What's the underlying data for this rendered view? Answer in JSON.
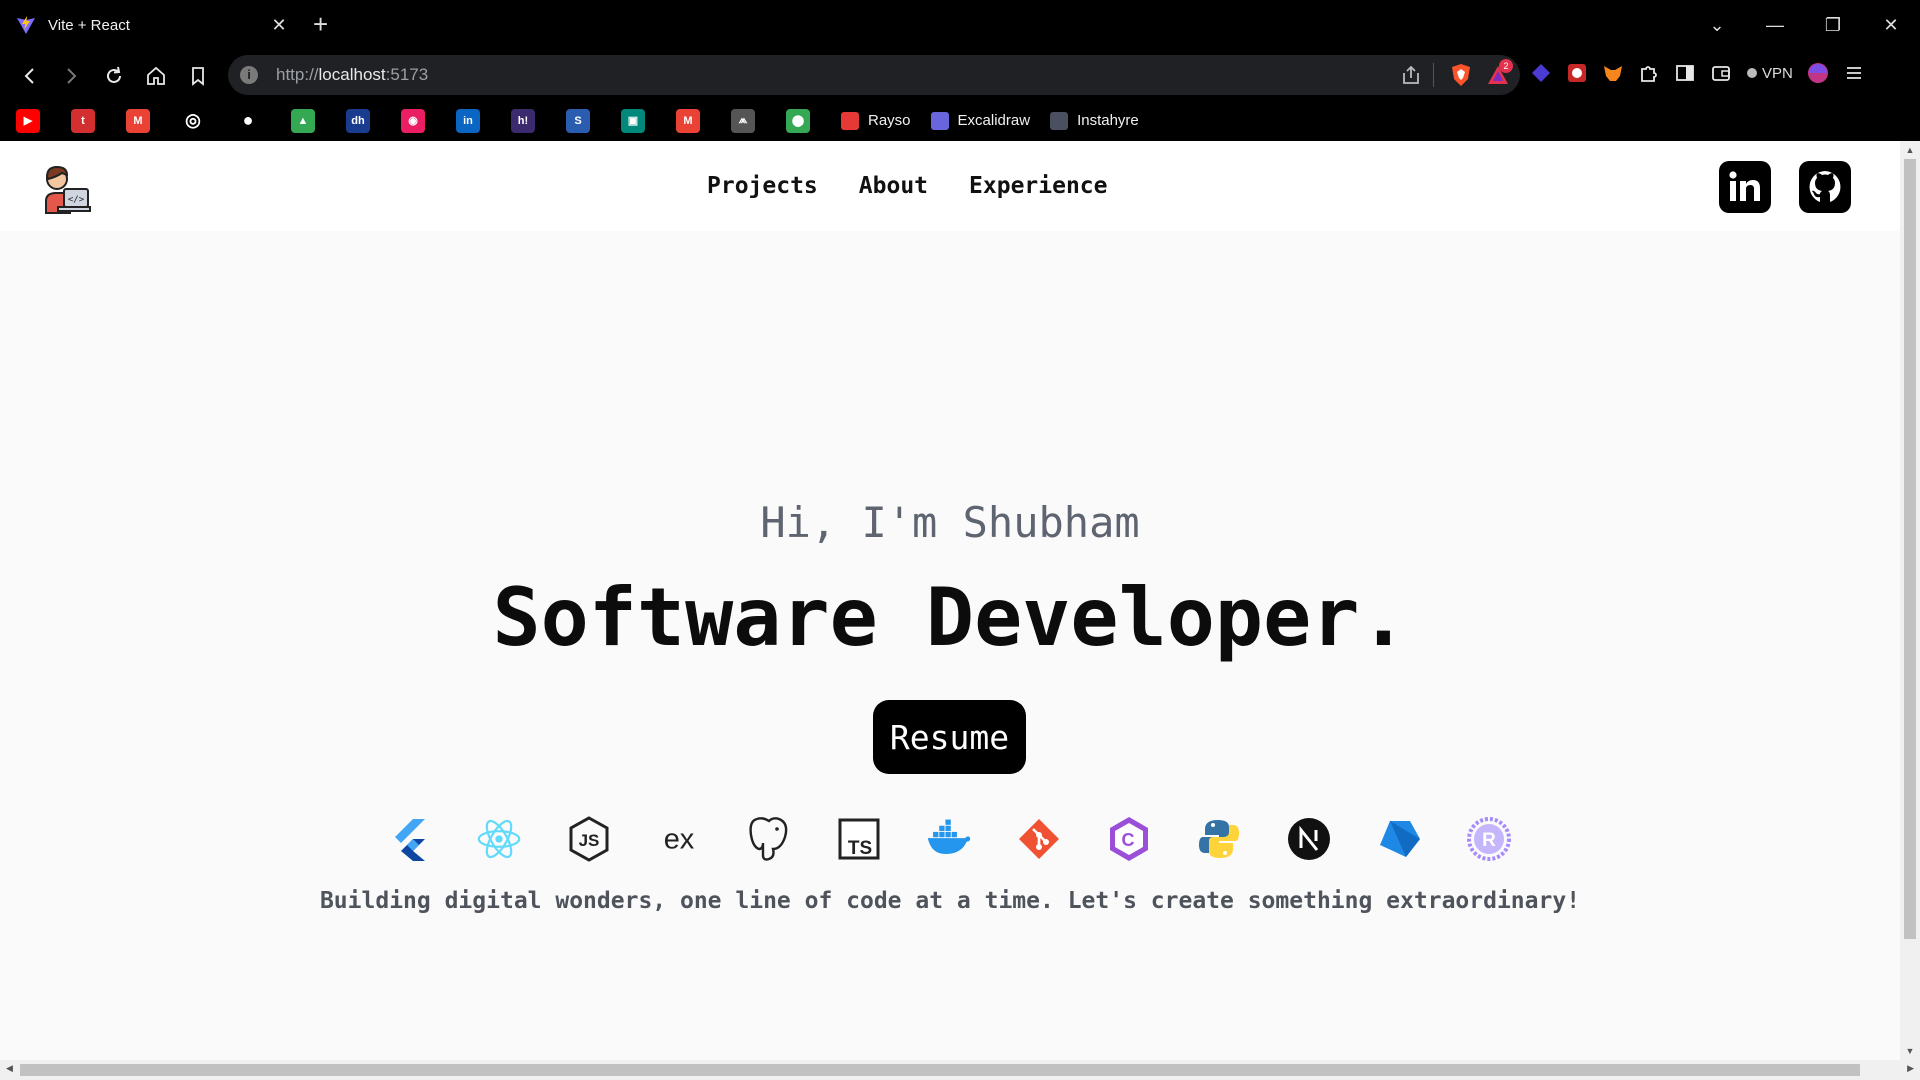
{
  "browser": {
    "tab_title": "Vite + React",
    "tab_close": "✕",
    "new_tab": "+",
    "window_controls": [
      "⌄",
      "—",
      "❐",
      "✕"
    ],
    "url_scheme": "http://",
    "url_host": "localhost",
    "url_port": ":5173",
    "vpn_label": "VPN",
    "rewards_badge": "2",
    "bookmarks": [
      {
        "icon": "youtube-icon",
        "color": "#ff0000",
        "glyph": "▶"
      },
      {
        "icon": "app-icon",
        "color": "#d32f2f",
        "glyph": "t"
      },
      {
        "icon": "gmail-icon",
        "color": "#ea4335",
        "glyph": "M"
      },
      {
        "icon": "chatgpt-icon",
        "color": "#ffffff",
        "glyph": "◎"
      },
      {
        "icon": "github-icon",
        "color": "#ffffff",
        "glyph": "●"
      },
      {
        "icon": "google-drive-icon",
        "color": "#34a853",
        "glyph": "▲"
      },
      {
        "icon": "dh-icon",
        "color": "#1a3c8f",
        "glyph": "dh"
      },
      {
        "icon": "dribbble-icon",
        "color": "#e91e63",
        "glyph": "◉"
      },
      {
        "icon": "linkedin-icon",
        "color": "#0a66c2",
        "glyph": "in"
      },
      {
        "icon": "hackerearth-icon",
        "color": "#3b2a6e",
        "glyph": "h!"
      },
      {
        "icon": "swift-icon",
        "color": "#2a5db0",
        "glyph": "S"
      },
      {
        "icon": "google-meet-icon",
        "color": "#00897b",
        "glyph": "▣"
      },
      {
        "icon": "gmail-alt-icon",
        "color": "#ea4335",
        "glyph": "M"
      },
      {
        "icon": "aws-icon",
        "color": "#555555",
        "glyph": "⩕"
      },
      {
        "icon": "google-maps-icon",
        "color": "#34a853",
        "glyph": "⬤"
      }
    ],
    "named_bookmarks": [
      {
        "label": "Rayso",
        "icon": "rayso-icon",
        "color": "#e53935"
      },
      {
        "label": "Excalidraw",
        "icon": "excalidraw-icon",
        "color": "#6965db"
      },
      {
        "label": "Instahyre",
        "icon": "instahyre-icon",
        "color": "#4a5060"
      }
    ]
  },
  "site": {
    "nav": [
      "Projects",
      "About",
      "Experience"
    ],
    "hero": {
      "greeting": "Hi, I'm Shubham",
      "title": "Software Developer.",
      "resume_label": "Resume",
      "tagline": "Building digital wonders, one line of code at a time. Let's create something extraordinary!"
    },
    "tech_icons": [
      "flutter-icon",
      "react-icon",
      "nodejs-icon",
      "express-icon",
      "postgresql-icon",
      "typescript-icon",
      "docker-icon",
      "git-icon",
      "csharp-icon",
      "python-icon",
      "nextjs-icon",
      "dart-icon",
      "rust-icon"
    ],
    "social": [
      "linkedin-icon",
      "github-icon"
    ],
    "colors": {
      "accent": "#000000",
      "muted_text": "#5e6470"
    }
  }
}
